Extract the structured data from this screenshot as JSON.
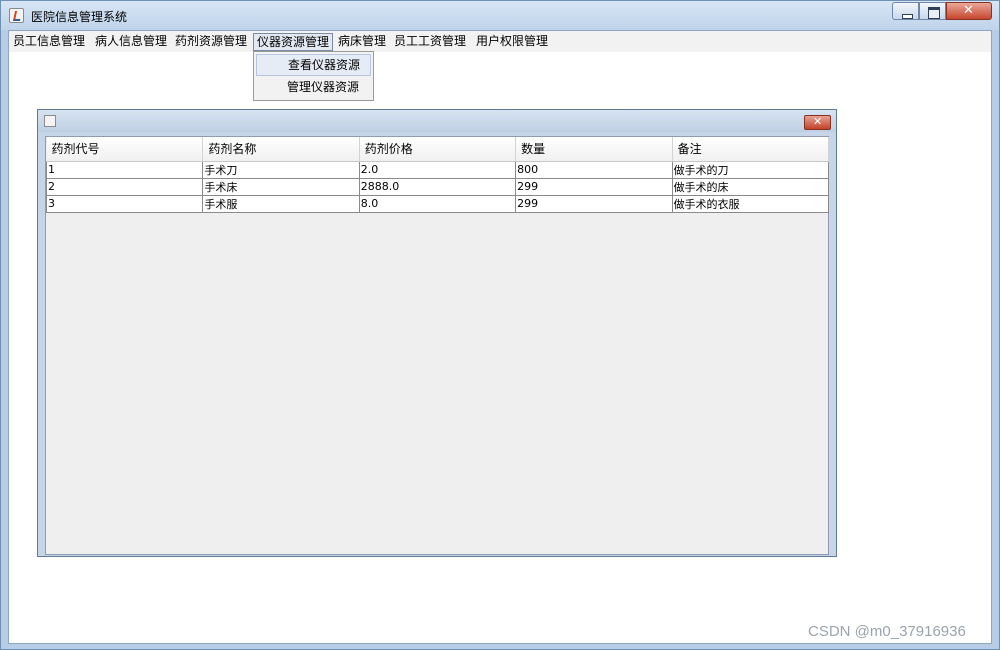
{
  "window": {
    "title": "医院信息管理系统"
  },
  "menubar": {
    "items": [
      {
        "label": "员工信息管理"
      },
      {
        "label": "病人信息管理"
      },
      {
        "label": "药剂资源管理"
      },
      {
        "label": "仪器资源管理",
        "active": true
      },
      {
        "label": "病床管理"
      },
      {
        "label": "员工工资管理"
      },
      {
        "label": "用户权限管理"
      }
    ]
  },
  "dropdown": {
    "items": [
      {
        "label": "查看仪器资源"
      },
      {
        "label": "管理仪器资源"
      }
    ]
  },
  "table": {
    "columns": [
      "药剂代号",
      "药剂名称",
      "药剂价格",
      "数量",
      "备注"
    ],
    "rows": [
      [
        "1",
        "手术刀",
        "2.0",
        "800",
        "做手术的刀"
      ],
      [
        "2",
        "手术床",
        "2888.0",
        "299",
        "做手术的床"
      ],
      [
        "3",
        "手术服",
        "8.0",
        "299",
        "做手术的衣服"
      ]
    ]
  },
  "watermark": "CSDN @m0_37916936"
}
